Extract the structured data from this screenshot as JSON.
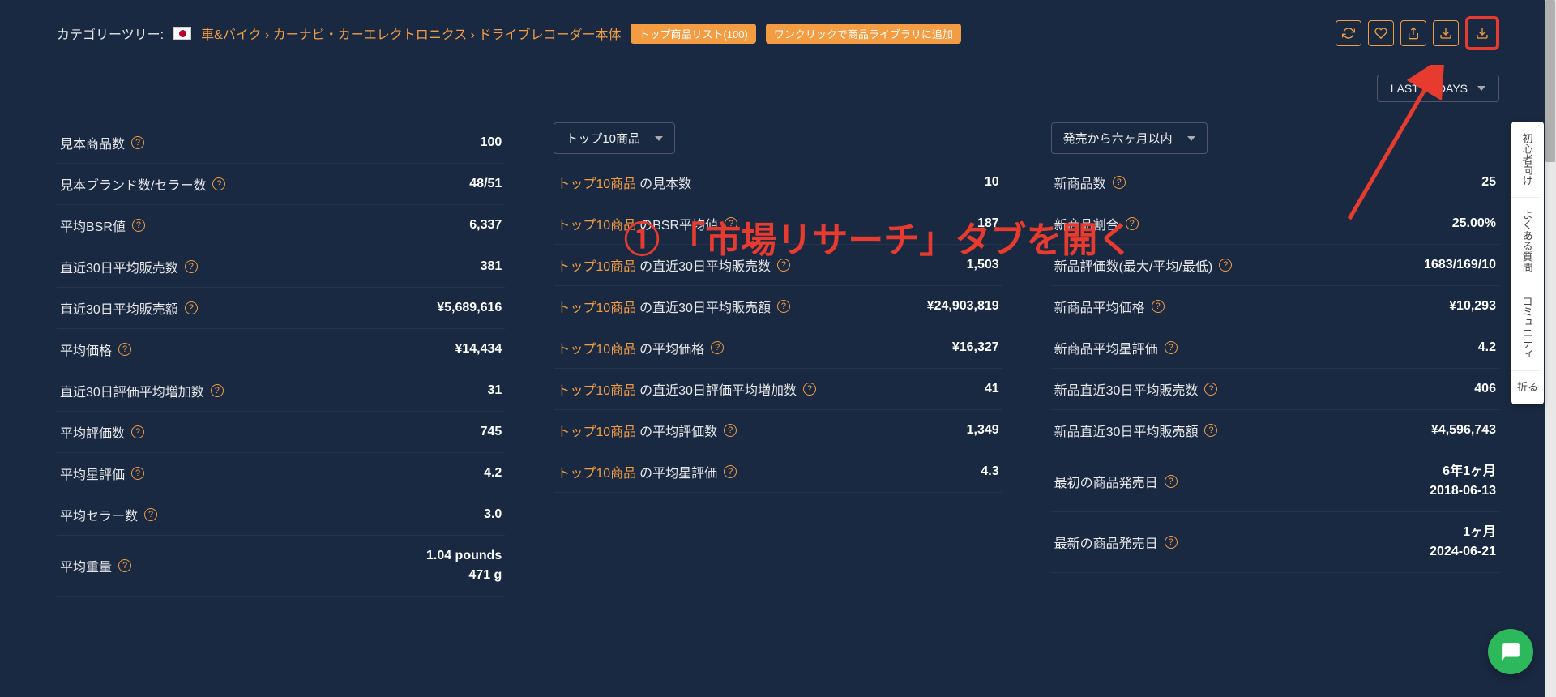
{
  "breadcrumb": {
    "label": "カテゴリーツリー:",
    "path": "車&バイク › カーナビ・カーエレクトロニクス › ドライブレコーダー本体"
  },
  "badges": {
    "top_list": "トップ商品リスト(100)",
    "one_click": "ワンクリックで商品ライブラリに追加"
  },
  "period_selector": "LAST 30 DAYS",
  "annotation": "① 「市場リサーチ」タブを開く",
  "panel1": {
    "rows": [
      {
        "label": "見本商品数",
        "value": "100",
        "help": true
      },
      {
        "label": "見本ブランド数/セラー数",
        "value": "48/51",
        "help": true
      },
      {
        "label": "平均BSR値",
        "value": "6,337",
        "help": true
      },
      {
        "label": "直近30日平均販売数",
        "value": "381",
        "help": true
      },
      {
        "label": "直近30日平均販売額",
        "value": "¥5,689,616",
        "help": true
      },
      {
        "label": "平均価格",
        "value": "¥14,434",
        "help": true
      },
      {
        "label": "直近30日評価平均増加数",
        "value": "31",
        "help": true
      },
      {
        "label": "平均評価数",
        "value": "745",
        "help": true
      },
      {
        "label": "平均星評価",
        "value": "4.2",
        "help": true
      },
      {
        "label": "平均セラー数",
        "value": "3.0",
        "help": true
      },
      {
        "label": "平均重量",
        "value": [
          "1.04 pounds",
          "471 g"
        ],
        "help": true
      }
    ]
  },
  "panel2": {
    "dropdown": "トップ10商品",
    "rows": [
      {
        "prefix": "トップ10商品",
        "suffix": "の見本数",
        "value": "10",
        "help": false
      },
      {
        "prefix": "トップ10商品",
        "suffix": "のBSR平均値",
        "value": "187",
        "help": true
      },
      {
        "prefix": "トップ10商品",
        "suffix": "の直近30日平均販売数",
        "value": "1,503",
        "help": true
      },
      {
        "prefix": "トップ10商品",
        "suffix": "の直近30日平均販売額",
        "value": "¥24,903,819",
        "help": true
      },
      {
        "prefix": "トップ10商品",
        "suffix": "の平均価格",
        "value": "¥16,327",
        "help": true
      },
      {
        "prefix": "トップ10商品",
        "suffix": "の直近30日評価平均増加数",
        "value": "41",
        "help": true
      },
      {
        "prefix": "トップ10商品",
        "suffix": "の平均評価数",
        "value": "1,349",
        "help": true
      },
      {
        "prefix": "トップ10商品",
        "suffix": "の平均星評価",
        "value": "4.3",
        "help": true
      }
    ]
  },
  "panel3": {
    "dropdown": "発売から六ヶ月以内",
    "rows": [
      {
        "label": "新商品数",
        "value": "25",
        "help": true
      },
      {
        "label": "新商品割合",
        "value": "25.00%",
        "help": true
      },
      {
        "label": "新品評価数(最大/平均/最低)",
        "value": "1683/169/10",
        "help": true
      },
      {
        "label": "新商品平均価格",
        "value": "¥10,293",
        "help": true
      },
      {
        "label": "新商品平均星評価",
        "value": "4.2",
        "help": true
      },
      {
        "label": "新品直近30日平均販売数",
        "value": "406",
        "help": true
      },
      {
        "label": "新品直近30日平均販売額",
        "value": "¥4,596,743",
        "help": true
      },
      {
        "label": "最初の商品発売日",
        "value": [
          "6年1ヶ月",
          "2018-06-13"
        ],
        "help": true
      },
      {
        "label": "最新の商品発売日",
        "value": [
          "1ヶ月",
          "2024-06-21"
        ],
        "help": true
      }
    ]
  },
  "side_help": {
    "beginner": "初心者向け",
    "faq": "よくある質問",
    "community": "コミュニティ",
    "collapse": "折る"
  }
}
